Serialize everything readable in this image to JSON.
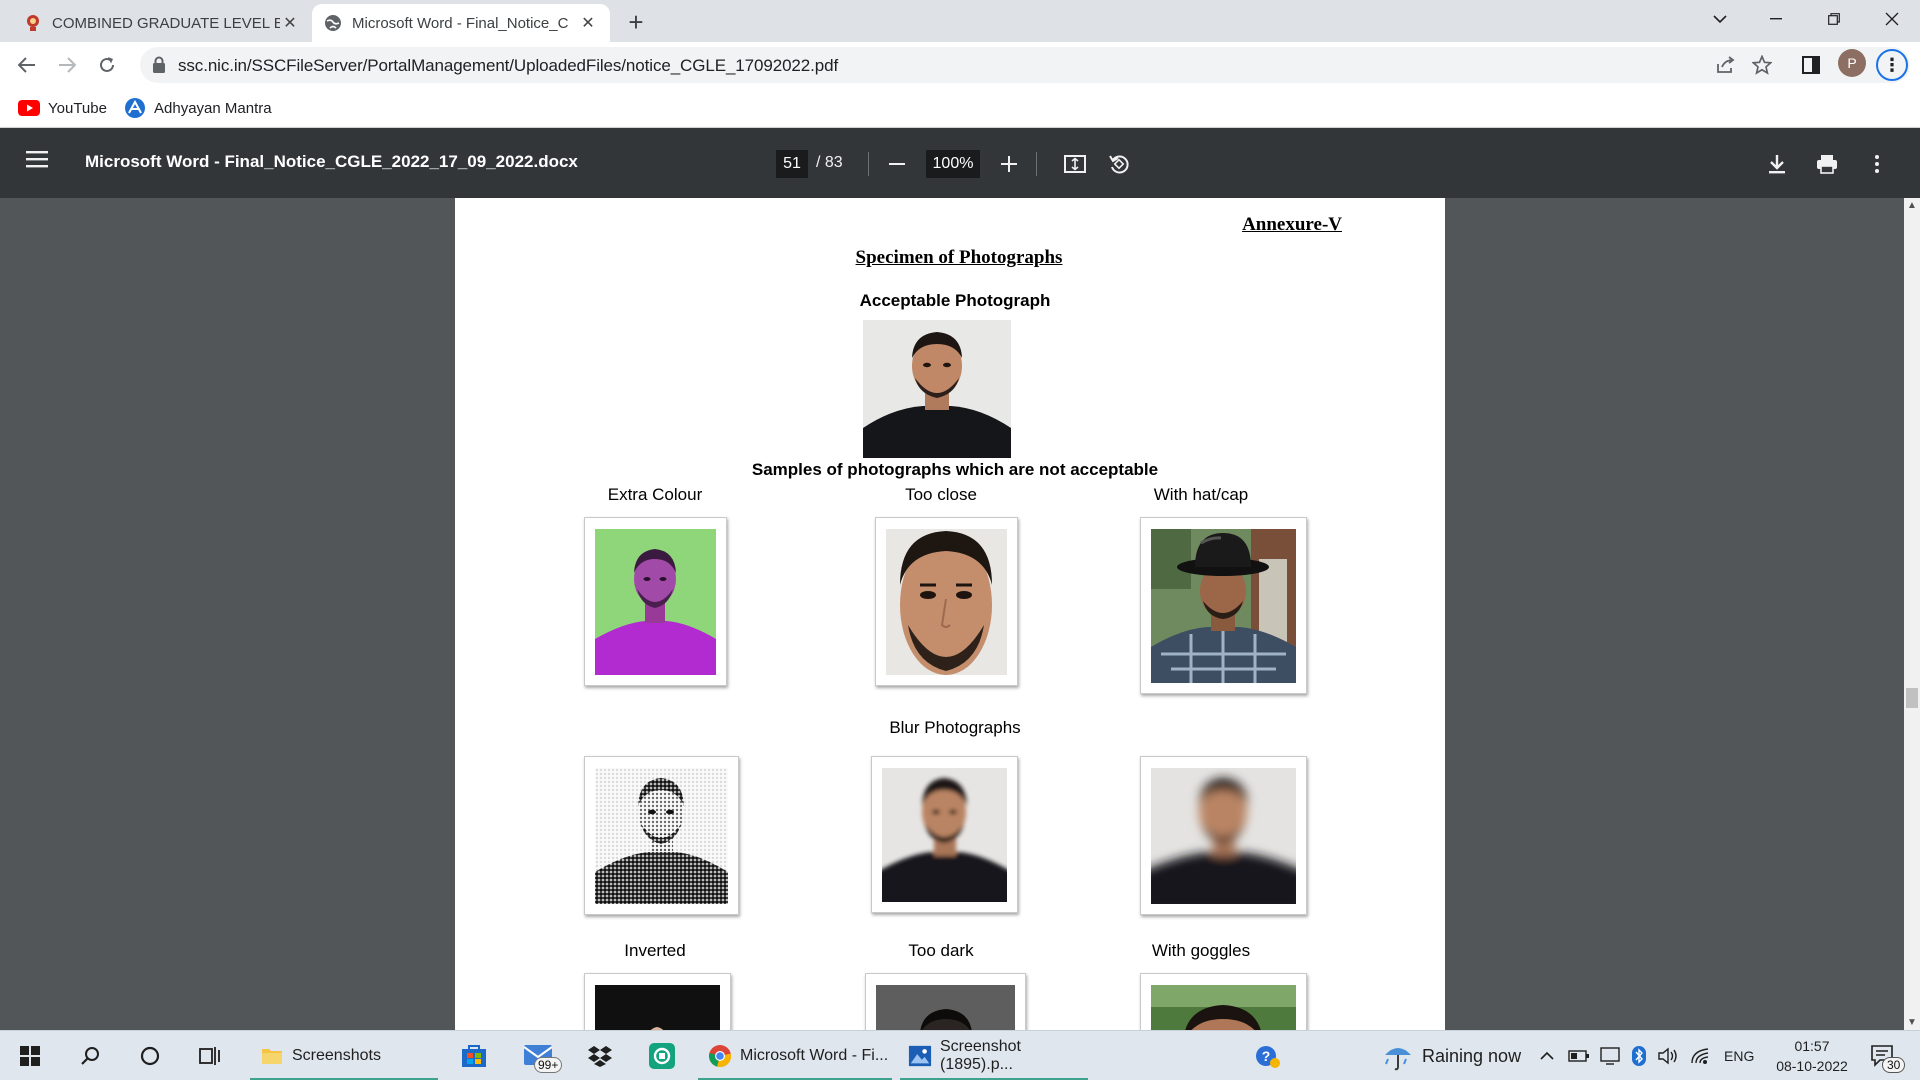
{
  "browser": {
    "tabs": [
      {
        "title": "COMBINED GRADUATE LEVEL EX",
        "favicon": "ssc-emblem-icon",
        "active": false
      },
      {
        "title": "Microsoft Word - Final_Notice_C",
        "favicon": "globe-icon",
        "active": true
      }
    ],
    "new_tab_symbol": "+",
    "url": "ssc.nic.in/SSCFileServer/PortalManagement/UploadedFiles/notice_CGLE_17092022.pdf",
    "profile_initial": "P",
    "bookmarks": [
      {
        "label": "YouTube",
        "icon": "youtube-icon"
      },
      {
        "label": "Adhyayan Mantra",
        "icon": "adhyayan-icon"
      }
    ]
  },
  "pdf_viewer": {
    "title": "Microsoft Word - Final_Notice_CGLE_2022_17_09_2022.docx",
    "current_page": "51",
    "total_pages": "/ 83",
    "zoom": "100%"
  },
  "document": {
    "annexure": "Annexure-V",
    "heading": "Specimen of Photographs",
    "acceptable_label": "Acceptable Photograph",
    "not_acceptable_label": "Samples of photographs which are not acceptable",
    "row1_labels": [
      "Extra Colour",
      "Too close",
      "With hat/cap"
    ],
    "blur_label": "Blur Photographs",
    "row3_labels": [
      "Inverted",
      "Too dark",
      "With goggles"
    ]
  },
  "taskbar": {
    "apps": [
      {
        "label": "Screenshots",
        "icon": "folder-icon"
      },
      {
        "label": "Microsoft Word - Fi...",
        "icon": "chrome-icon"
      },
      {
        "label": "Screenshot (1895).p...",
        "icon": "photos-icon"
      }
    ],
    "mail_badge": "99+",
    "weather": "Raining now",
    "language": "ENG",
    "time": "01:57",
    "date": "08-10-2022",
    "notification_count": "30"
  },
  "colors": {
    "pdf_toolbar": "#323639",
    "viewer_bg": "#525659",
    "extra_colour_bg": "#8fd67a",
    "extra_colour_shirt": "#b22bd1",
    "taskbar_accent": "#3fa28f"
  }
}
